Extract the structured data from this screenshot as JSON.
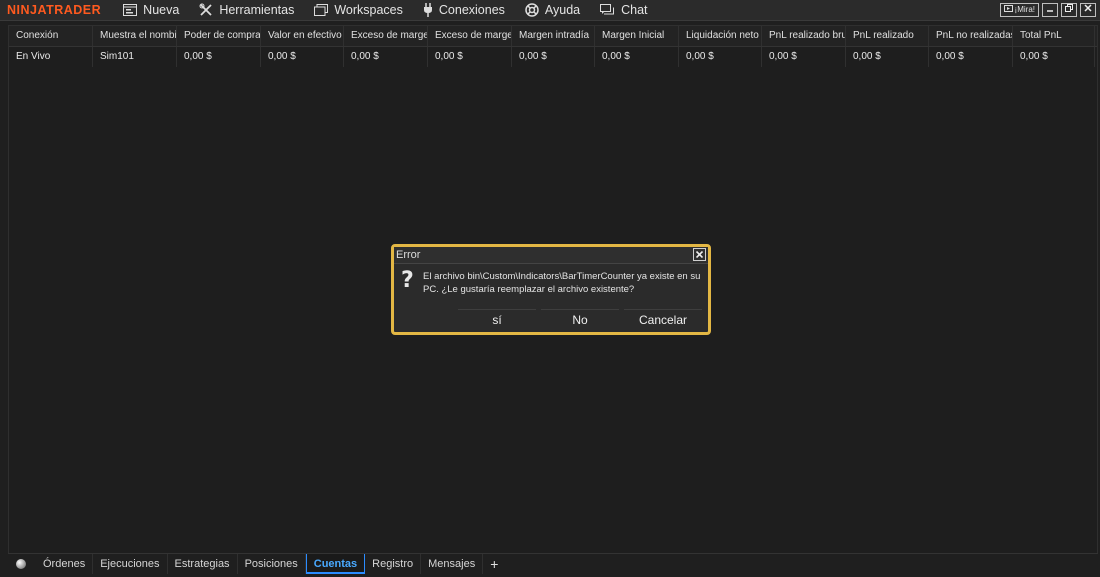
{
  "app": {
    "logo": "NINJATRADER"
  },
  "menu": {
    "items": [
      {
        "label": "Nueva",
        "icon": "new-window-icon"
      },
      {
        "label": "Herramientas",
        "icon": "tools-icon"
      },
      {
        "label": "Workspaces",
        "icon": "workspaces-icon"
      },
      {
        "label": "Conexiones",
        "icon": "plug-icon"
      },
      {
        "label": "Ayuda",
        "icon": "lifebuoy-icon"
      },
      {
        "label": "Chat",
        "icon": "chat-icon"
      }
    ],
    "watch_label": "¡Mira!"
  },
  "grid": {
    "columns": [
      "Conexión",
      "Muestra el nombi",
      "Poder de compra",
      "Valor en efectivo",
      "Exceso de marge",
      "Exceso de marge",
      "Margen intradía",
      "Margen Inicial",
      "Liquidación neto",
      "PnL realizado bru",
      "PnL realizado",
      "PnL no realizadas",
      "Total PnL"
    ],
    "rows": [
      [
        "En Vivo",
        "Sim101",
        "0,00 $",
        "0,00 $",
        "0,00 $",
        "0,00 $",
        "0,00 $",
        "0,00 $",
        "0,00 $",
        "0,00 $",
        "0,00 $",
        "0,00 $",
        "0,00 $"
      ]
    ]
  },
  "tabs": {
    "items": [
      "Órdenes",
      "Ejecuciones",
      "Estrategias",
      "Posiciones",
      "Cuentas",
      "Registro",
      "Mensajes"
    ],
    "active": "Cuentas",
    "add": "+"
  },
  "dialog": {
    "title": "Error",
    "message": "El archivo bin\\Custom\\Indicators\\BarTimerCounter ya existe en su PC. ¿Le gustaría reemplazar el archivo existente?",
    "icon": "?",
    "buttons": {
      "yes": "sí",
      "no": "No",
      "cancel": "Cancelar"
    }
  },
  "colors": {
    "logo": "#ff5a1f",
    "dialog_border": "#e3b744",
    "active_tab": "#49a9ff",
    "background": "#1f1f1f"
  }
}
